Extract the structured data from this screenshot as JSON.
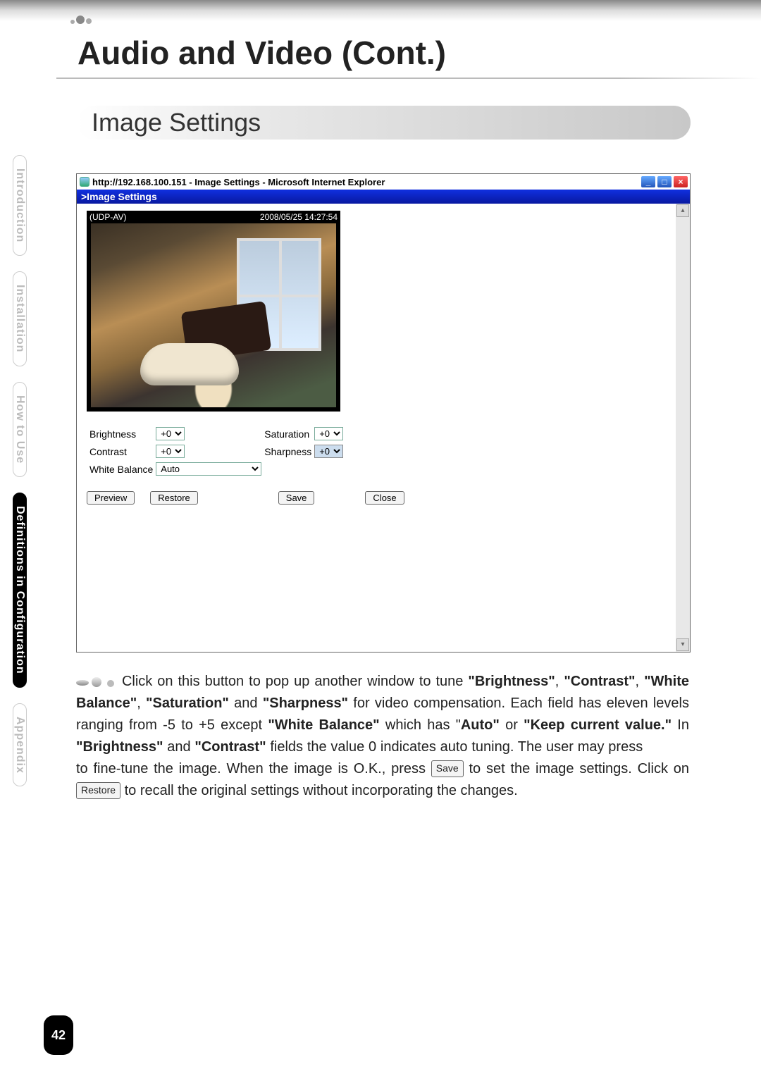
{
  "page": {
    "heading": "Audio and Video (Cont.)",
    "section_heading": "Image Settings",
    "page_number": "42"
  },
  "sidebar": {
    "items": [
      {
        "label": "Introduction",
        "active": false
      },
      {
        "label": "Installation",
        "active": false
      },
      {
        "label": "How to Use",
        "active": false
      },
      {
        "label": "Definitions in Configuration",
        "active": true
      },
      {
        "label": "Appendix",
        "active": false
      }
    ]
  },
  "screenshot": {
    "window_title": "http://192.168.100.151 - Image Settings - Microsoft Internet Explorer",
    "blue_bar": ">Image Settings",
    "camera_label": "(UDP-AV)",
    "timestamp": "2008/05/25 14:27:54",
    "controls": {
      "brightness_label": "Brightness",
      "brightness_value": "+0",
      "contrast_label": "Contrast",
      "contrast_value": "+0",
      "white_balance_label": "White Balance",
      "white_balance_value": "Auto",
      "saturation_label": "Saturation",
      "saturation_value": "+0",
      "sharpness_label": "Sharpness",
      "sharpness_value": "+0"
    },
    "buttons": {
      "preview": "Preview",
      "restore": "Restore",
      "save": "Save",
      "close": "Close"
    }
  },
  "paragraph": {
    "t1": " Click on this button to pop up another window to tune ",
    "b1": "\"Brightness\"",
    "t2": ", ",
    "b2": "\"Contrast\"",
    "t3": ", ",
    "b3": "\"White Balance\"",
    "t4": ", ",
    "b4": "\"Saturation\"",
    "t5": " and ",
    "b5": "\"Sharpness\"",
    "t6": " for video compensation. Each field has eleven levels ranging from -5 to +5 except ",
    "b6": "\"White Balance\"",
    "t7": " which has \"",
    "b7": "Auto\"",
    "t8": " or ",
    "b8": "\"Keep current value.\"",
    "t9": " In ",
    "b9": "\"Brightness\"",
    "t10": " and ",
    "b10": "\"Contrast\"",
    "t11": " fields the value 0 indicates auto tuning. The user may press ",
    "t12": " to fine-tune the image. When the image is O.K., press ",
    "inline_save": "Save",
    "t13": " to set the image settings. Click on ",
    "inline_restore": "Restore",
    "t14": " to recall the original settings without incorporating the changes."
  }
}
